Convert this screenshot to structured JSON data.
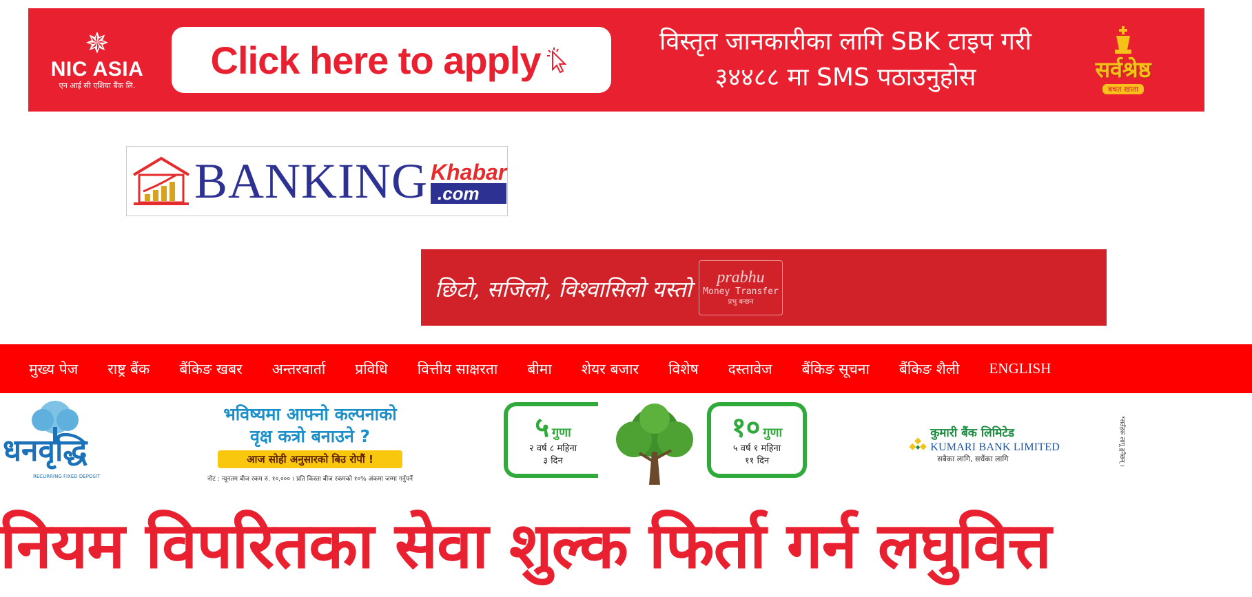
{
  "top_ad": {
    "brand_name": "NIC ASIA",
    "brand_sub": "एन आई सी एशिया बैंक लि.",
    "button_label": "Click here to apply",
    "sms_line1": "विस्तृत जानकारीका लागि SBK टाइप गरी",
    "sms_line2": "३४४८८ मा SMS पठाउनुहोस",
    "badge_text": "सर्वश्रेष्ठ",
    "badge_sub": "बचत खाता",
    "background": "#e8202f"
  },
  "site_logo": {
    "word_main": "BANKING",
    "word_khabar": "Khabar",
    "word_com": ".com",
    "icon": "house-chart-icon"
  },
  "prabhu_ad": {
    "tagline": "छिटो, सजिलो, विश्वासिलो यस्तो",
    "logo_name": "prabhu",
    "logo_service": "Money Transfer",
    "logo_sub": "प्रभु बन्छन",
    "background": "#d22229"
  },
  "nav": {
    "items": [
      "मुख्य पेज",
      "राष्ट्र बैंक",
      "बैंकिङ खबर",
      "अन्तरवार्ता",
      "प्रविधि",
      "वित्तीय साक्षरता",
      "बीमा",
      "शेयर बजार",
      "विशेष",
      "दस्तावेज",
      "बैंकिङ सूचना",
      "बैंकिङ शैली"
    ],
    "english": "ENGLISH",
    "background": "#fe0000"
  },
  "kumari_ad": {
    "product_name": "धनवृद्धि",
    "product_sub": "RECURRING FIXED DEPOSIT",
    "headline1": "भविष्यमा आफ्नो कल्पनाको",
    "headline2": "वृक्ष कत्रो बनाउने ?",
    "yellow_strip": "आज सोही अनुसारको बिउ रोपौं !",
    "note": "नोट : न्यूनतम बीज रकम रु. १०,००० । प्रति किस्ता बीज रकमको १०% अंकमा जम्मा गर्नुपर्ने",
    "offer_left": {
      "num": "५",
      "word": "गुणा",
      "line1": "२ वर्ष ८ महिना",
      "line2": "३ दिन"
    },
    "offer_right": {
      "num": "१०",
      "word": "गुणा",
      "line1": "५ वर्ष १ महिना",
      "line2": "११ दिन"
    },
    "bank_np": "कुमारी बैंक लिमिटेड",
    "bank_en": "KUMARI BANK LIMITED",
    "bank_tag": "सबैका लागि, सधैंका लागि",
    "vertical_note": "*सर्तहरू लागू हुनेछन् ।",
    "accent_green": "#2faa3b",
    "accent_blue": "#1b8fc9"
  },
  "article": {
    "headline": "नियम विपरितका सेवा शुल्क फिर्ता गर्न लघुवित्त"
  }
}
